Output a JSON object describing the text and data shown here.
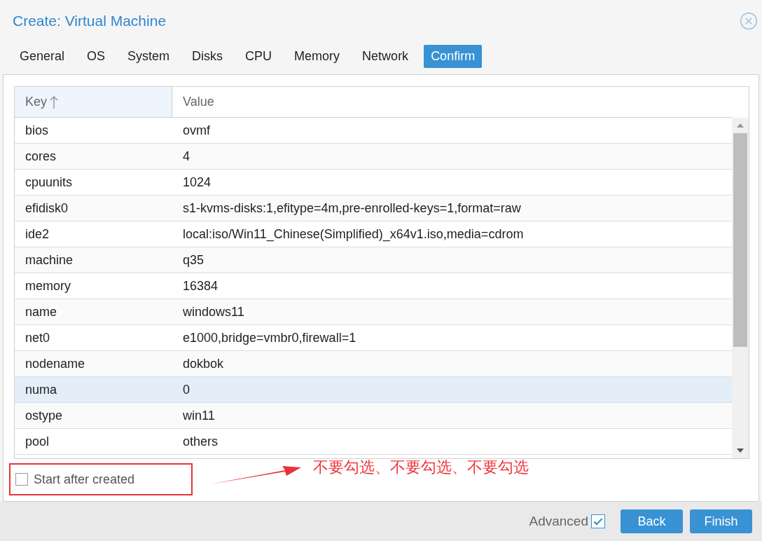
{
  "window": {
    "title": "Create: Virtual Machine"
  },
  "tabs": [
    {
      "label": "General",
      "selected": false
    },
    {
      "label": "OS",
      "selected": false
    },
    {
      "label": "System",
      "selected": false
    },
    {
      "label": "Disks",
      "selected": false
    },
    {
      "label": "CPU",
      "selected": false
    },
    {
      "label": "Memory",
      "selected": false
    },
    {
      "label": "Network",
      "selected": false
    },
    {
      "label": "Confirm",
      "selected": true
    }
  ],
  "table": {
    "columns": [
      {
        "label": "Key",
        "sorted": true
      },
      {
        "label": "Value",
        "sorted": false
      }
    ],
    "rows": [
      {
        "key": "bios",
        "value": "ovmf",
        "selected": false
      },
      {
        "key": "cores",
        "value": "4",
        "selected": false
      },
      {
        "key": "cpuunits",
        "value": "1024",
        "selected": false
      },
      {
        "key": "efidisk0",
        "value": "s1-kvms-disks:1,efitype=4m,pre-enrolled-keys=1,format=raw",
        "selected": false
      },
      {
        "key": "ide2",
        "value": "local:iso/Win11_Chinese(Simplified)_x64v1.iso,media=cdrom",
        "selected": false
      },
      {
        "key": "machine",
        "value": "q35",
        "selected": false
      },
      {
        "key": "memory",
        "value": "16384",
        "selected": false
      },
      {
        "key": "name",
        "value": "windows11",
        "selected": false
      },
      {
        "key": "net0",
        "value": "e1000,bridge=vmbr0,firewall=1",
        "selected": false
      },
      {
        "key": "nodename",
        "value": "dokbok",
        "selected": false
      },
      {
        "key": "numa",
        "value": "0",
        "selected": true
      },
      {
        "key": "ostype",
        "value": "win11",
        "selected": false
      },
      {
        "key": "pool",
        "value": "others",
        "selected": false
      }
    ]
  },
  "start_after_created": {
    "label": "Start after created",
    "checked": false
  },
  "annotation": {
    "text": "不要勾选、不要勾选、不要勾选"
  },
  "footer": {
    "advanced": {
      "label": "Advanced",
      "checked": true
    },
    "buttons": [
      {
        "label": "Back"
      },
      {
        "label": "Finish"
      }
    ]
  }
}
